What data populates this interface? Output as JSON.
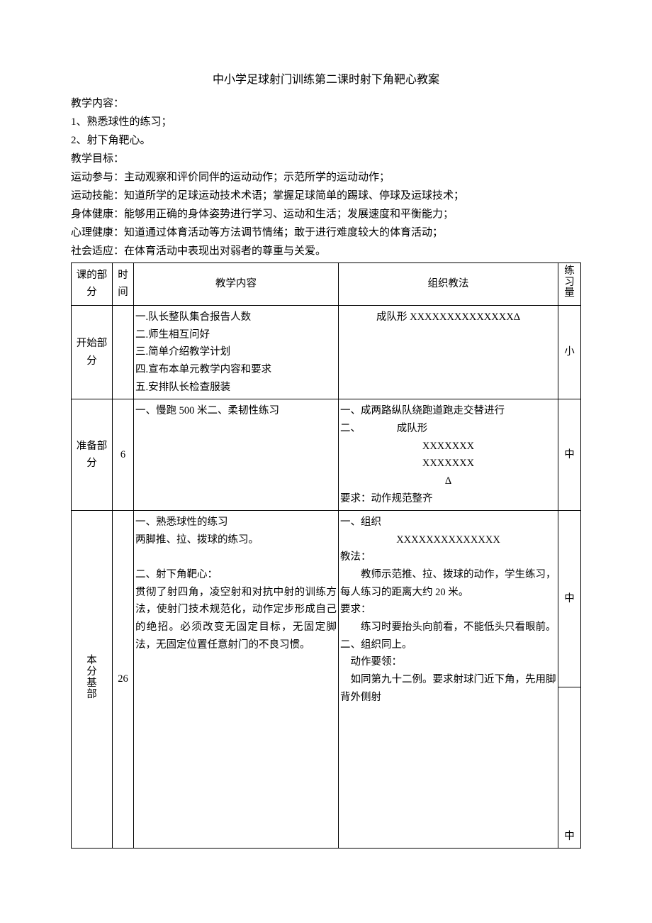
{
  "title": "中小学足球射门训练第二课时射下角靶心教案",
  "intro": {
    "h_content": "教学内容：",
    "c1": "1、熟悉球性的练习；",
    "c2": "2、射下角靶心。",
    "h_goal": "教学目标：",
    "g1": "运动参与：主动观察和评价同伴的运动动作；示范所学的运动动作；",
    "g2": "运动技能：知道所学的足球运动技术术语；掌握足球简单的踢球、停球及运球技术；",
    "g3": "身体健康：能够用正确的身体姿势进行学习、运动和生活；发展速度和平衡能力；",
    "g4": "心理健康：知道通过体育活动等方法调节情绪；敢于进行难度较大的体育活动；",
    "g5": "社会适应：在体育活动中表现出对弱者的尊重与关爱。"
  },
  "table": {
    "headers": {
      "part": "课的部分",
      "time": "时间",
      "content": "教学内容",
      "method": "组织教法",
      "amount": "练习量"
    },
    "rows": [
      {
        "part": "开始部分",
        "time": "",
        "content": "一.队长整队集合报告人数\n二.师生相互问好\n三.简单介绍教学计划\n四.宣布本单元教学内容和要求\n五.安排队长检查服装",
        "method_line1": "成队形 XXXXXXXXXXXXXXΔ",
        "amount": "小"
      },
      {
        "part": "准备部分",
        "time": "6",
        "content": "一、慢跑 500 米二、柔韧性练习",
        "method": {
          "l1": "一、成两路纵队绕跑道跑走交替进行",
          "l2": "二、　　　　成队形",
          "l3": "XXXXXXX",
          "l4": "XXXXXXX",
          "l5": "Δ",
          "l6": "要求：动作规范整齐"
        },
        "amount": "中"
      },
      {
        "part": "本分基部",
        "time": "26",
        "content": {
          "p1": "一、熟悉球性的练习",
          "p2": "两脚推、拉、拨球的练习。",
          "p3": "二、射下角靶心：",
          "p4": "贯彻了射四角，凌空射和对抗中射的训练方法，使射门技术规范化，动作定步形成自己的绝招。必须改变无固定目标，无固定脚法，无固定位置任意射门的不良习惯。"
        },
        "method": {
          "l1": "一、组织",
          "l2": "XXXXXXXXXXXXXX",
          "l3": "教法：",
          "l4": "　　教师示范推、拉、拨球的动作，学生练习，每人练习的距离大约 20 米。",
          "l5": "要求：",
          "l6": "　　练习时要抬头向前看，不能低头只看眼前。",
          "l7": "二、组织同上。",
          "l8": "　动作要领：",
          "l9": "　如同第九十二例。要求射球门近下角，先用脚背外侧射"
        },
        "amount1": "中",
        "amount2": "中"
      }
    ]
  }
}
